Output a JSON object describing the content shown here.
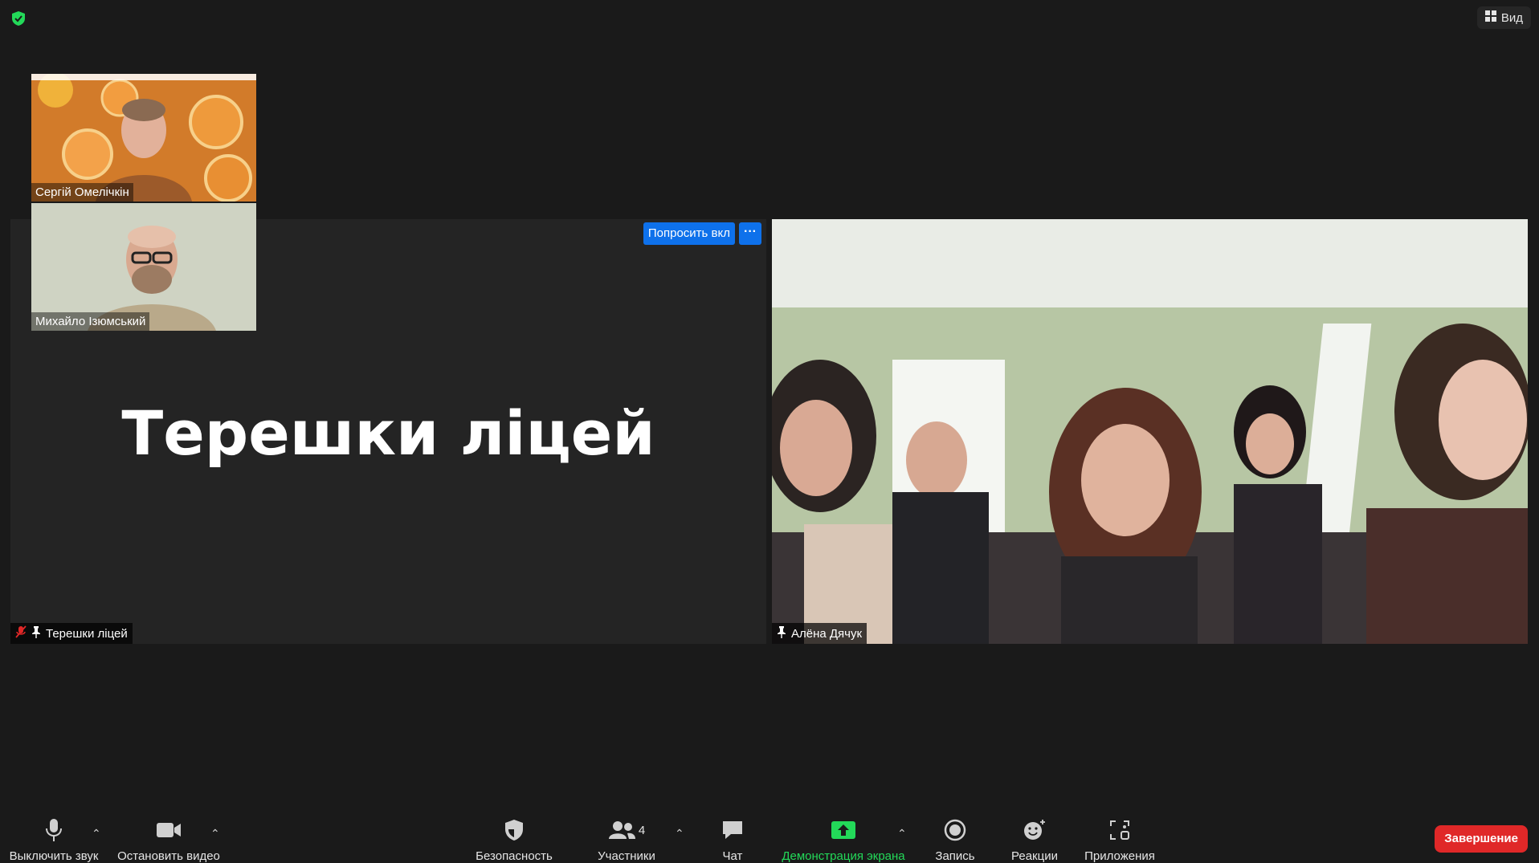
{
  "top": {
    "view_label": "Вид"
  },
  "thumbnails": [
    {
      "name": "Сергій Омелічкін"
    },
    {
      "name": "Михайло Ізюмський"
    }
  ],
  "main_tile": {
    "display_name": "Терешки ліцей",
    "ask_button": "Попросить вкл",
    "more_button": "···",
    "name_label": "Терешки ліцей"
  },
  "right_tile": {
    "name_label": "Алёна Дячук"
  },
  "toolbar": {
    "mute": "Выключить звук",
    "video": "Остановить видео",
    "security": "Безопасность",
    "participants": "Участники",
    "participants_count": "4",
    "chat": "Чат",
    "share": "Демонстрация экрана",
    "record": "Запись",
    "reactions": "Реакции",
    "apps": "Приложения",
    "end": "Завершение"
  },
  "colors": {
    "accent": "#0e71eb",
    "share_green": "#23d959",
    "end_red": "#e02828"
  }
}
